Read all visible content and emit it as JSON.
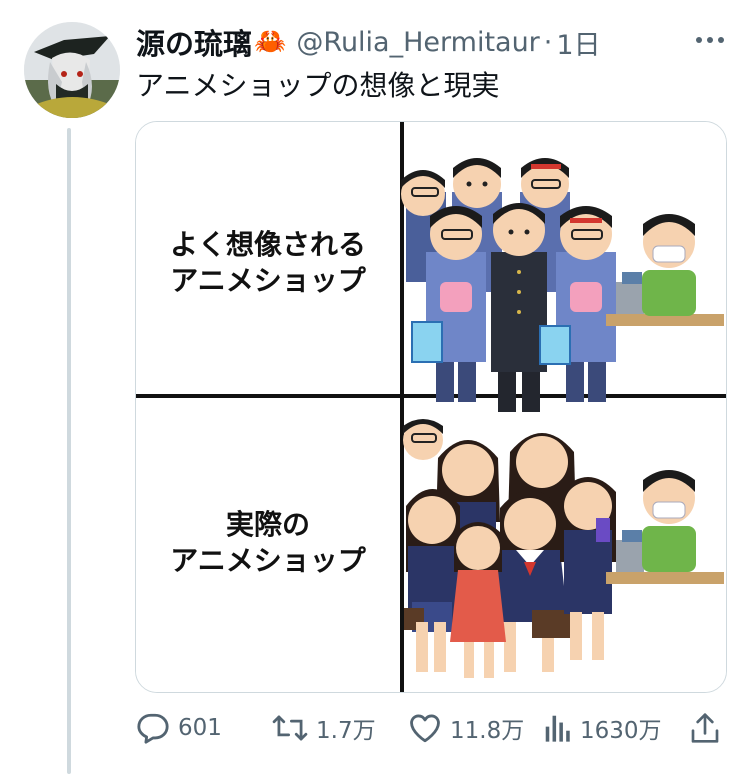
{
  "tweet": {
    "display_name": "源の琉璃",
    "name_emoji": "🦀",
    "handle": "@Rulia_Hermitaur",
    "separator": "·",
    "time": "1日",
    "text": "アニメショップの想像と現実"
  },
  "media": {
    "top_caption_line1": "よく想像される",
    "top_caption_line2": "アニメショップ",
    "bottom_caption_line1": "実際の",
    "bottom_caption_line2": "アニメショップ"
  },
  "actions": {
    "reply_count": "601",
    "retweet_count": "1.7万",
    "like_count": "11.8万",
    "view_count": "1630万"
  },
  "colors": {
    "text": "#0f1419",
    "secondary": "#536471",
    "thread_line": "#cfd9de",
    "border": "#cfd9de"
  }
}
